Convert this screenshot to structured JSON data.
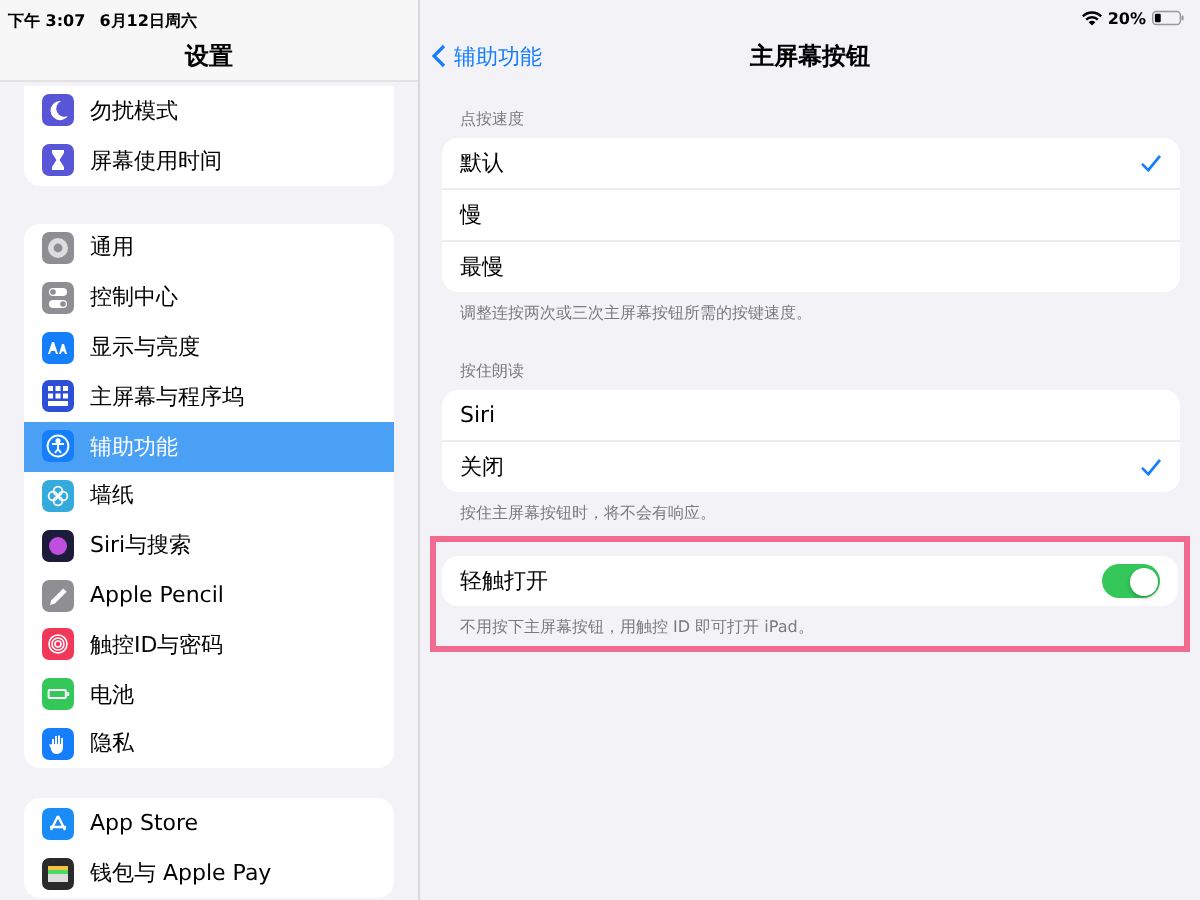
{
  "status_bar": {
    "time": "下午 3:07",
    "date": "6月12日周六",
    "battery": "20%"
  },
  "sidebar": {
    "title": "设置",
    "groups": [
      [
        {
          "label": "勿扰模式",
          "kind": "moon",
          "color": "#5856d6",
          "selected": false
        },
        {
          "label": "屏幕使用时间",
          "kind": "hourglass",
          "color": "#5856d6",
          "selected": false
        }
      ],
      [
        {
          "label": "通用",
          "kind": "gear",
          "color": "#8e8e93",
          "selected": false
        },
        {
          "label": "控制中心",
          "kind": "toggles",
          "color": "#8e8e93",
          "selected": false
        },
        {
          "label": "显示与亮度",
          "kind": "letters",
          "color": "#147efb",
          "selected": false
        },
        {
          "label": "主屏幕与程序坞",
          "kind": "grid",
          "color": "#2c4fd6",
          "selected": false
        },
        {
          "label": "辅助功能",
          "kind": "person",
          "color": "#147efb",
          "selected": true
        },
        {
          "label": "墙纸",
          "kind": "flower",
          "color": "#35aadc",
          "selected": false
        },
        {
          "label": "Siri与搜索",
          "kind": "orb",
          "color": "#1c1c3a",
          "selected": false
        },
        {
          "label": "Apple Pencil",
          "kind": "pencil",
          "color": "#8e8e93",
          "selected": false
        },
        {
          "label": "触控ID与密码",
          "kind": "fingerprint",
          "color": "#f2385a",
          "selected": false
        },
        {
          "label": "电池",
          "kind": "battery",
          "color": "#34c759",
          "selected": false
        },
        {
          "label": "隐私",
          "kind": "hand",
          "color": "#147efb",
          "selected": false
        }
      ],
      [
        {
          "label": "App Store",
          "kind": "store",
          "color": "#1a8cf7",
          "selected": false
        },
        {
          "label": "钱包与 Apple Pay",
          "kind": "wallet",
          "color": "#2b2b2b",
          "selected": false
        }
      ]
    ]
  },
  "detail": {
    "back": "辅助功能",
    "title": "主屏幕按钮",
    "sections": [
      {
        "kind": "choice",
        "highlighted": false,
        "header": "点按速度",
        "rows": [
          {
            "label": "默认",
            "selected": true
          },
          {
            "label": "慢",
            "selected": false
          },
          {
            "label": "最慢",
            "selected": false
          }
        ],
        "footer": "调整连按两次或三次主屏幕按钮所需的按键速度。"
      },
      {
        "kind": "choice",
        "highlighted": false,
        "header": "按住朗读",
        "rows": [
          {
            "label": "Siri",
            "selected": false
          },
          {
            "label": "关闭",
            "selected": true
          }
        ],
        "footer": "按住主屏幕按钮时，将不会有响应。"
      },
      {
        "kind": "switch",
        "highlighted": true,
        "rows": [
          {
            "label": "轻触打开",
            "on": true
          }
        ],
        "footer": "不用按下主屏幕按钮，用触控 ID 即可打开 iPad。"
      }
    ]
  }
}
